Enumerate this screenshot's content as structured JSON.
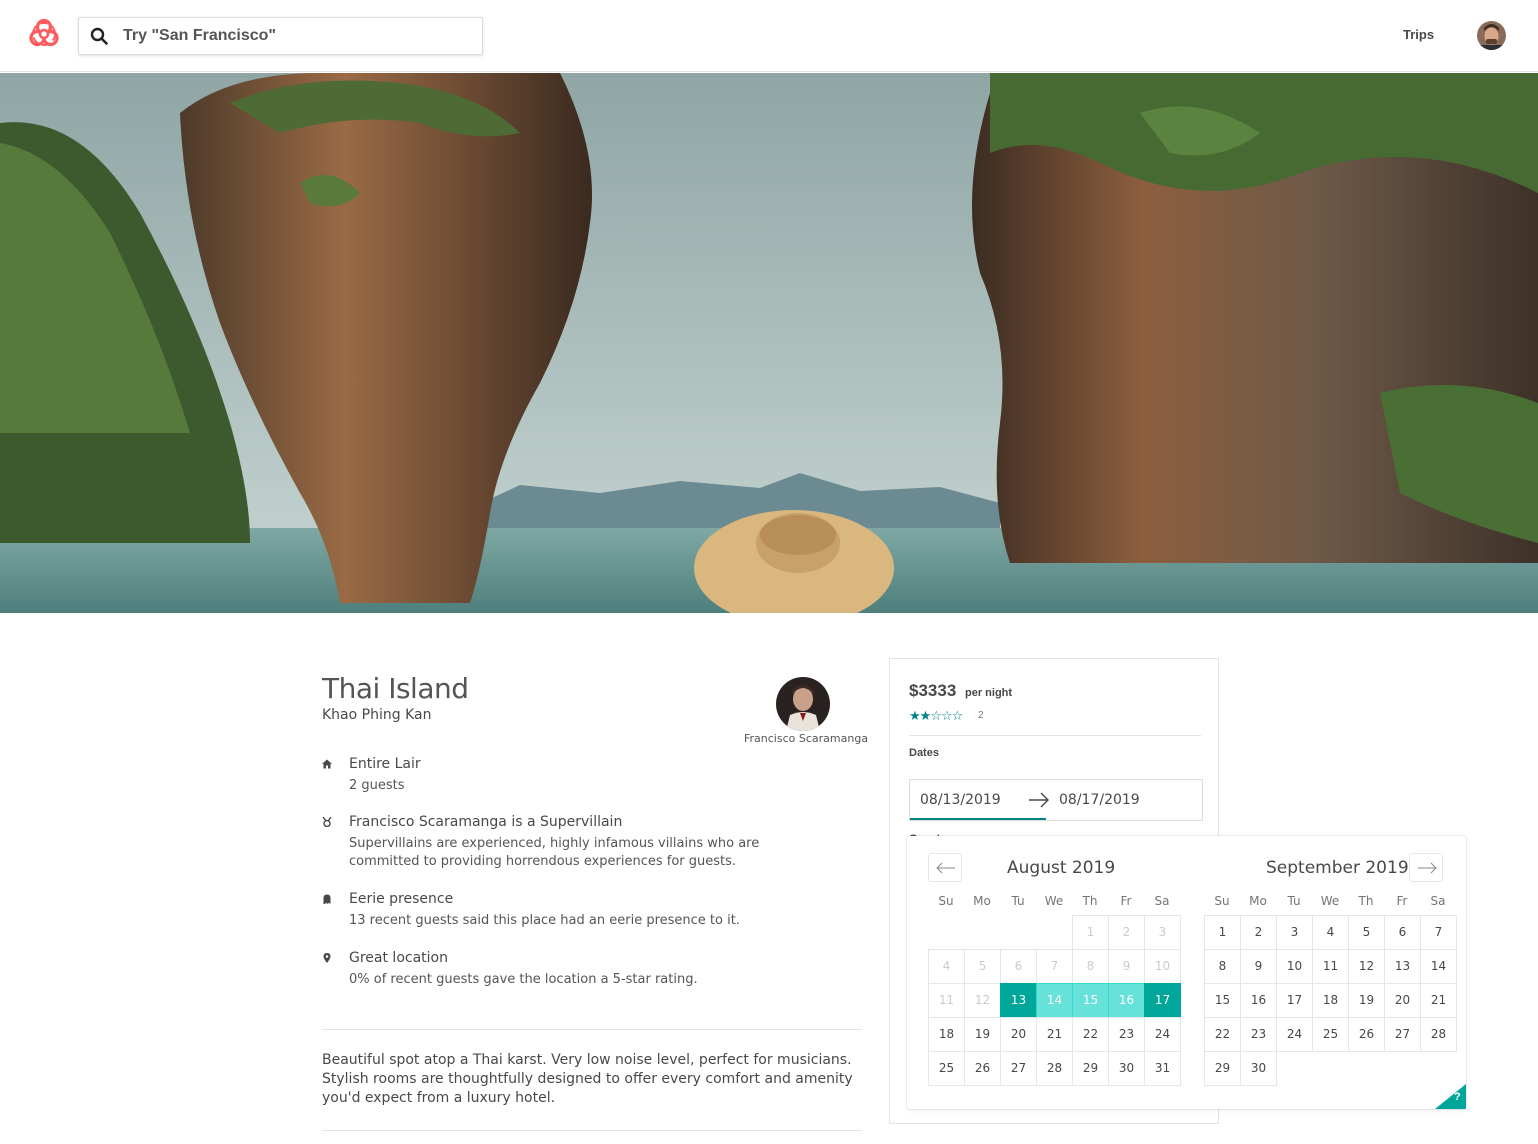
{
  "header": {
    "logo_icon": "biohazard-icon",
    "search_placeholder": "Try \"San Francisco\"",
    "trips_label": "Trips",
    "brand_color": "#ff5a5f"
  },
  "listing": {
    "title": "Thai Island",
    "location": "Khao Phing Kan",
    "host_name": "Francisco Scaramanga",
    "features": [
      {
        "icon": "home-icon",
        "title": "Entire Lair",
        "detail": "2 guests"
      },
      {
        "icon": "medal-icon",
        "title": "Francisco Scaramanga is a Supervillain",
        "detail": "Supervillains are experienced, highly infamous villains who are committed to providing horrendous experiences for guests."
      },
      {
        "icon": "ghost-icon",
        "title": "Eerie presence",
        "detail": "13 recent guests said this place had an eerie presence to it."
      },
      {
        "icon": "location-pin-icon",
        "title": "Great location",
        "detail": "0% of recent guests gave the location a 5-star rating."
      }
    ],
    "description": "Beautiful spot atop a Thai karst. Very low noise level, perfect for musicians. Stylish rooms are thoughtfully designed to offer every comfort and amenity you'd expect from a luxury hotel."
  },
  "booking": {
    "price": "$3333",
    "per_night": "per night",
    "rating_stars": 2,
    "rating_max": 5,
    "review_count": "2",
    "dates_label": "Dates",
    "check_in": "08/13/2019",
    "check_out": "08/17/2019",
    "guests_label": "Guests",
    "accent_color": "#008489"
  },
  "calendar": {
    "weekdays": [
      "Su",
      "Mo",
      "Tu",
      "We",
      "Th",
      "Fr",
      "Sa"
    ],
    "months": [
      {
        "title": "August 2019",
        "first_weekday": 4,
        "days": 31,
        "blocked_through": 12
      },
      {
        "title": "September 2019",
        "first_weekday": 0,
        "days": 30,
        "blocked_through": 0
      }
    ],
    "selection": {
      "month": 0,
      "start": 13,
      "end": 17
    },
    "selected_color": "#00a699",
    "span_color": "#66e2da",
    "help_label": "?"
  }
}
